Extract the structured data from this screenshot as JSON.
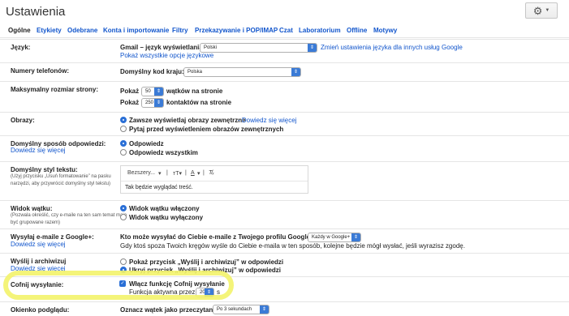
{
  "header": {
    "title": "Ustawienia"
  },
  "toolbar": {
    "gear_icon": "gear-icon",
    "caret_icon": "chevron-down-icon"
  },
  "tabs": [
    {
      "label": "Ogólne",
      "active": true
    },
    {
      "label": "Etykiety"
    },
    {
      "label": "Odebrane"
    },
    {
      "label": "Konta i importowanie"
    },
    {
      "label": "Filtry"
    },
    {
      "label": "Przekazywanie i POP/IMAP"
    },
    {
      "label": "Czat"
    },
    {
      "label": "Laboratorium"
    },
    {
      "label": "Offline"
    },
    {
      "label": "Motywy"
    }
  ],
  "settings": {
    "language": {
      "label": "Język:",
      "field_label": "Gmail – język wyświetlania:",
      "value": "Polski",
      "link": "Zmień ustawienia języka dla innych usług Google",
      "all_options_link": "Pokaż wszystkie opcje językowe"
    },
    "phone": {
      "label": "Numery telefonów:",
      "field_label": "Domyślny kod kraju:",
      "value": "Polska"
    },
    "page_size": {
      "label": "Maksymalny rozmiar strony:",
      "show": "Pokaż",
      "threads_value": "50",
      "threads_suffix": "wątków na stronie",
      "contacts_value": "250",
      "contacts_suffix": "kontaktów na stronie"
    },
    "images": {
      "label": "Obrazy:",
      "opt1": "Zawsze wyświetlaj obrazy zewnętrzne",
      "opt1_link": "- Dowiedz się więcej",
      "opt2": "Pytaj przed wyświetleniem obrazów zewnętrznych"
    },
    "reply": {
      "label": "Domyślny sposób odpowiedzi:",
      "learn_more": "Dowiedz się więcej",
      "opt1": "Odpowiedz",
      "opt2": "Odpowiedz wszystkim"
    },
    "text_style": {
      "label": "Domyślny styl tekstu:",
      "desc1": "(Użyj przycisku „Usuń formatowanie” na pasku",
      "desc2": "narzędzi, aby przywrócić domyślny styl tekstu)",
      "font": "Bezszery...",
      "size_icon": "font-size-icon",
      "color_icon": "text-color-icon",
      "clear_icon": "clear-format-icon",
      "preview": "Tak będzie wyglądać treść."
    },
    "conversation": {
      "label": "Widok wątku:",
      "desc1": "(Pozwala określić, czy e-maile na ten sam temat mają",
      "desc2": "być grupowane razem)",
      "opt1": "Widok wątku włączony",
      "opt2": "Widok wątku wyłączony"
    },
    "google_plus": {
      "label": "Wysyłaj e-maile z Google+:",
      "learn_more": "Dowiedz się więcej",
      "question": "Kto może wysyłać do Ciebie e-maile z Twojego profilu Google+?",
      "value": "Każdy w Google+",
      "desc": "Gdy ktoś spoza Twoich kręgów wyśle do Ciebie e-maila w ten sposób, kolejne będzie mógł wysłać, jeśli wyrazisz zgodę."
    },
    "send_archive": {
      "label": "Wyślij i archiwizuj",
      "learn_more": "Dowiedz się więcej",
      "opt1": "Pokaż przycisk „Wyślij i archiwizuj” w odpowiedzi",
      "opt2": "Ukryj przycisk „Wyślij i archiwizuj” w odpowiedzi"
    },
    "undo_send": {
      "label": "Cofnij wysyłanie:",
      "checkbox": "Włącz funkcję Cofnij wysyłanie",
      "period_label": "Funkcja aktywna przez",
      "value": "20",
      "unit": "s"
    },
    "preview_pane": {
      "label": "Okienko podglądu:",
      "field_label": "Oznacz wątek jako przeczytany:",
      "value": "Po 3 sekundach"
    }
  }
}
